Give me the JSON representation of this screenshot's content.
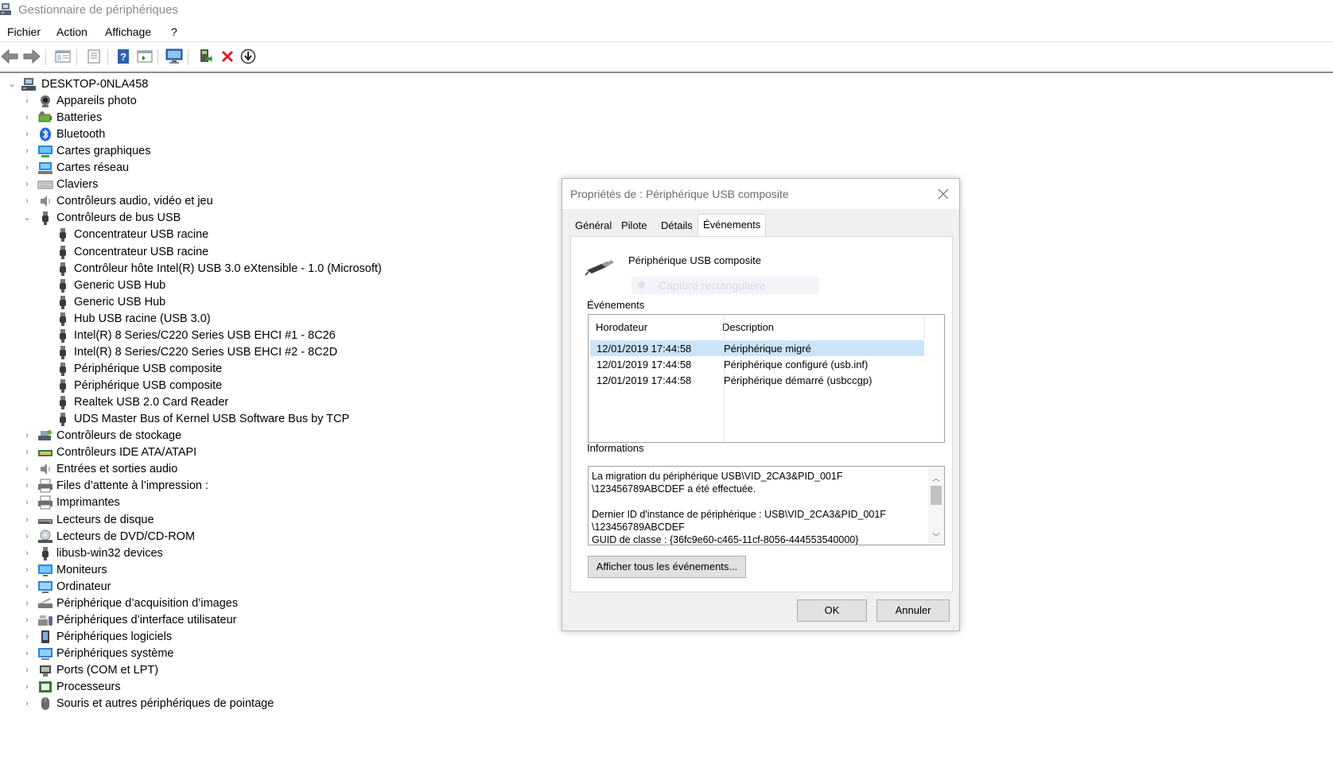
{
  "window": {
    "title": "Gestionnaire de périphériques"
  },
  "menu": [
    "Fichier",
    "Action",
    "Affichage",
    "?"
  ],
  "tree": {
    "root": "DESKTOP-0NLA458",
    "categories": [
      {
        "label": "Appareils photo",
        "icon": "camera-icon"
      },
      {
        "label": "Batteries",
        "icon": "battery-icon"
      },
      {
        "label": "Bluetooth",
        "icon": "bluetooth-icon"
      },
      {
        "label": "Cartes graphiques",
        "icon": "display-adapter-icon"
      },
      {
        "label": "Cartes réseau",
        "icon": "network-adapter-icon"
      },
      {
        "label": "Claviers",
        "icon": "keyboard-icon"
      },
      {
        "label": "Contrôleurs audio, vidéo et jeu",
        "icon": "speaker-icon"
      },
      {
        "label": "Contrôleurs de bus USB",
        "icon": "usb-icon",
        "expanded": true,
        "children": [
          "Concentrateur USB racine",
          "Concentrateur USB racine",
          "Contrôleur hôte Intel(R) USB 3.0 eXtensible - 1.0 (Microsoft)",
          "Generic USB Hub",
          "Generic USB Hub",
          "Hub USB racine (USB 3.0)",
          "Intel(R) 8 Series/C220 Series USB EHCI #1 - 8C26",
          "Intel(R) 8 Series/C220 Series USB EHCI #2 - 8C2D",
          "Périphérique USB composite",
          "Périphérique USB composite",
          "Realtek USB 2.0 Card Reader",
          "UDS Master Bus of Kernel USB Software Bus by TCP"
        ]
      },
      {
        "label": "Contrôleurs de stockage",
        "icon": "storage-icon"
      },
      {
        "label": "Contrôleurs IDE ATA/ATAPI",
        "icon": "ide-icon"
      },
      {
        "label": "Entrées et sorties audio",
        "icon": "speaker-icon"
      },
      {
        "label": "Files d’attente à l’impression :",
        "icon": "printer-icon"
      },
      {
        "label": "Imprimantes",
        "icon": "printer-icon"
      },
      {
        "label": "Lecteurs de disque",
        "icon": "disk-icon"
      },
      {
        "label": "Lecteurs de DVD/CD-ROM",
        "icon": "dvd-icon"
      },
      {
        "label": "libusb-win32 devices",
        "icon": "usb-icon"
      },
      {
        "label": "Moniteurs",
        "icon": "monitor-icon"
      },
      {
        "label": "Ordinateur",
        "icon": "computer-icon"
      },
      {
        "label": "Périphérique d’acquisition d’images",
        "icon": "scanner-icon"
      },
      {
        "label": "Périphériques d’interface utilisateur",
        "icon": "hid-icon"
      },
      {
        "label": "Périphériques logiciels",
        "icon": "software-device-icon"
      },
      {
        "label": "Périphériques système",
        "icon": "system-device-icon"
      },
      {
        "label": "Ports (COM et LPT)",
        "icon": "port-icon"
      },
      {
        "label": "Processeurs",
        "icon": "processor-icon"
      },
      {
        "label": "Souris et autres périphériques de pointage",
        "icon": "mouse-icon"
      }
    ]
  },
  "dialog": {
    "title": "Propriétés de : Périphérique USB composite",
    "tabs": [
      "Général",
      "Pilote",
      "Détails",
      "Événements"
    ],
    "active_tab": "Événements",
    "device_name": "Périphérique USB composite",
    "ghost_text": "Capture rectangulaire",
    "events_label": "Événements",
    "columns": [
      "Horodateur",
      "Description"
    ],
    "events": [
      {
        "time": "12/01/2019 17:44:58",
        "desc": "Périphérique migré",
        "selected": true
      },
      {
        "time": "12/01/2019 17:44:58",
        "desc": "Périphérique configuré (usb.inf)"
      },
      {
        "time": "12/01/2019 17:44:58",
        "desc": "Périphérique démarré (usbccgp)"
      }
    ],
    "info_label": "Informations",
    "info_text": [
      "La migration du périphérique USB\\VID_2CA3&PID_001F\n\\123456789ABCDEF a été effectuée.",
      "Dernier ID d'instance de périphérique : USB\\VID_2CA3&PID_001F\n\\123456789ABCDEF\nGUID de classe : {36fc9e60-c465-11cf-8056-444553540000}"
    ],
    "show_all_button": "Afficher tous les événements...",
    "ok_button": "OK",
    "cancel_button": "Annuler"
  },
  "colors": {
    "selection": "#cce4f7",
    "dialog_bg": "#f0f0f0",
    "delete_red": "#e81123"
  }
}
